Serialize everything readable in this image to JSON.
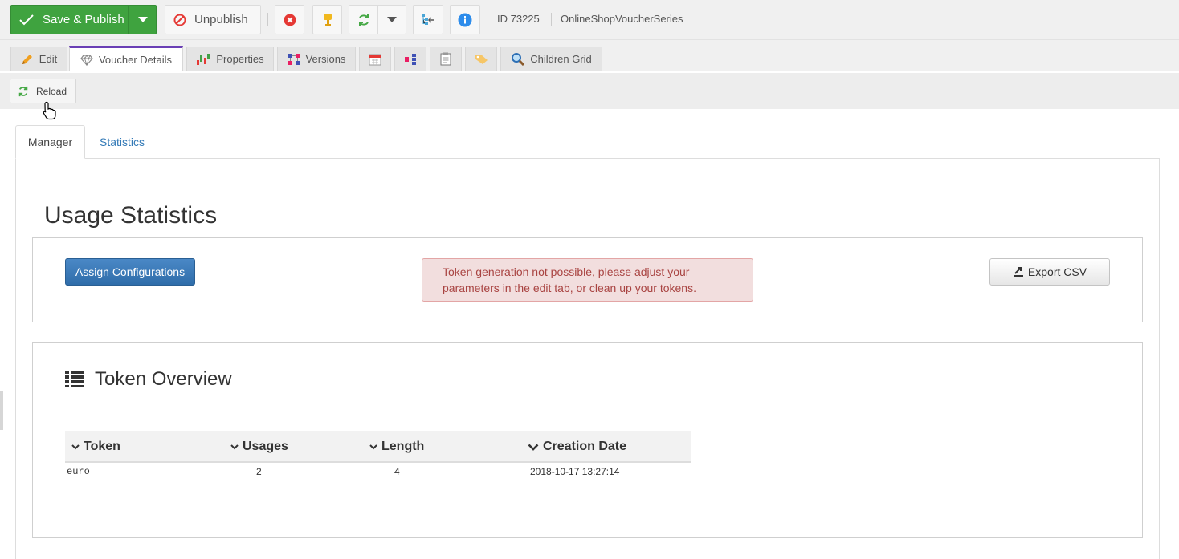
{
  "toolbar": {
    "save_label": "Save & Publish",
    "unpublish_label": "Unpublish",
    "id_text": "ID 73225",
    "key_text": "OnlineShopVoucherSeries"
  },
  "object_tabs": [
    {
      "label": "Edit",
      "icon": "pencil-icon"
    },
    {
      "label": "Voucher Details",
      "icon": "diamond-icon",
      "active": true
    },
    {
      "label": "Properties",
      "icon": "properties-icon"
    },
    {
      "label": "Versions",
      "icon": "versions-icon"
    },
    {
      "label": "",
      "icon": "calendar-icon"
    },
    {
      "label": "",
      "icon": "dependencies-icon"
    },
    {
      "label": "",
      "icon": "clipboard-icon"
    },
    {
      "label": "",
      "icon": "tag-icon"
    },
    {
      "label": "Children Grid",
      "icon": "search-icon"
    }
  ],
  "subtoolbar": {
    "reload_label": "Reload"
  },
  "inner_tabs": {
    "manager": "Manager",
    "statistics": "Statistics"
  },
  "usage": {
    "title": "Usage Statistics",
    "assign_label": "Assign Configurations",
    "alert_text": "Token generation not possible, please adjust your parameters in the edit tab, or clean up your tokens.",
    "export_label": "Export CSV"
  },
  "tokens": {
    "title": "Token Overview",
    "columns": [
      "Token",
      "Usages",
      "Length",
      "Creation Date"
    ],
    "rows": [
      {
        "token": "euro",
        "usages": "2",
        "length": "4",
        "creation_date": "2018-10-17 13:27:14"
      }
    ]
  },
  "colors": {
    "save_green": "#3fa33f",
    "active_tab_accent": "#6a3fb5",
    "primary_blue": "#337ab7",
    "alert_bg": "#f2dede",
    "alert_text": "#a94442"
  }
}
